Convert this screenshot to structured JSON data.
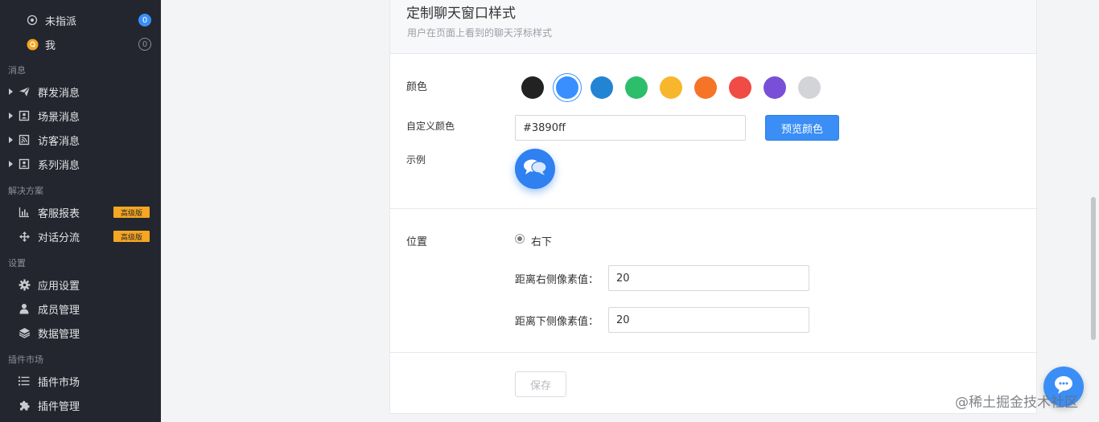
{
  "sidebar": {
    "top_items": [
      {
        "label": "未指派",
        "icon": "target-icon",
        "badge": "0"
      },
      {
        "label": "我",
        "icon": "avatar-icon",
        "badge": "0"
      }
    ],
    "sections": {
      "messages": "消息",
      "solutions": "解决方案",
      "settings": "设置",
      "plugins": "插件市场"
    },
    "message_items": [
      {
        "label": "群发消息",
        "icon": "send-icon"
      },
      {
        "label": "场景消息",
        "icon": "contact-card-icon"
      },
      {
        "label": "访客消息",
        "icon": "rss-icon"
      },
      {
        "label": "系列消息",
        "icon": "contact-card-icon"
      }
    ],
    "solution_items": [
      {
        "label": "客服报表",
        "icon": "bar-chart-icon",
        "tag": "高级版"
      },
      {
        "label": "对话分流",
        "icon": "split-arrows-icon",
        "tag": "高级版"
      }
    ],
    "settings_items": [
      {
        "label": "应用设置",
        "icon": "gear-icon"
      },
      {
        "label": "成员管理",
        "icon": "user-icon"
      },
      {
        "label": "数据管理",
        "icon": "layers-icon"
      }
    ],
    "plugin_items": [
      {
        "label": "插件市场",
        "icon": "list-icon"
      },
      {
        "label": "插件管理",
        "icon": "puzzle-icon"
      }
    ]
  },
  "card": {
    "title": "定制聊天窗口样式",
    "subtitle": "用户在页面上看到的聊天浮标样式",
    "color_label": "颜色",
    "swatches": [
      "#222222",
      "#3890ff",
      "#2484d4",
      "#2dbe6c",
      "#f8b62c",
      "#f57427",
      "#f04b45",
      "#7a4fd8",
      "#d2d4d8"
    ],
    "selected_swatch": "#3890ff",
    "custom_color_label": "自定义颜色",
    "custom_color_value": "#3890ff",
    "preview_button": "预览颜色",
    "example_label": "示例",
    "position_label": "位置",
    "position_option": "右下",
    "right_offset_label": "距离右侧像素值：",
    "right_offset_value": "20",
    "bottom_offset_label": "距离下侧像素值：",
    "bottom_offset_value": "20",
    "save_button": "保存"
  },
  "watermark": "@稀土掘金技术社区"
}
